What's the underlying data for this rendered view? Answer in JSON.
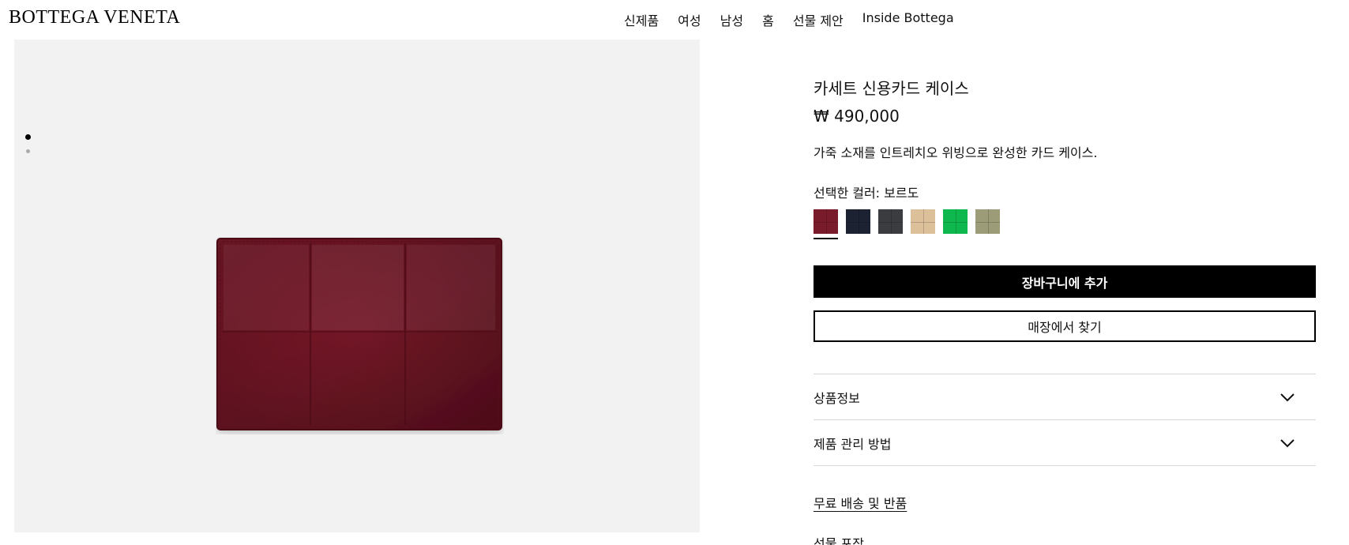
{
  "header": {
    "brand": "BOTTEGA VENETA",
    "nav": [
      "신제품",
      "여성",
      "남성",
      "홈",
      "선물 제안",
      "Inside Bottega"
    ]
  },
  "gallery": {
    "image_count": 2,
    "active_index": 0
  },
  "product": {
    "title": "카세트 신용카드 케이스",
    "price": "₩ 490,000",
    "description": "가죽 소재를 인트레치오 위빙으로 완성한 카드 케이스.",
    "selected_color_label": "선택한 컬러: 보르도",
    "swatches": [
      {
        "color": "#7a1b2b",
        "selected": true
      },
      {
        "color": "#1d2233",
        "selected": false
      },
      {
        "color": "#3b3c40",
        "selected": false
      },
      {
        "color": "#dcc09a",
        "selected": false
      },
      {
        "color": "#0fb84f",
        "selected": false
      },
      {
        "color": "#9c9c78",
        "selected": false
      }
    ],
    "add_to_cart_label": "장바구니에 추가",
    "find_in_store_label": "매장에서 찾기",
    "accordion": [
      "상품정보",
      "제품 관리 방법"
    ],
    "links": [
      "무료 배송 및 반품",
      "선물 포장"
    ]
  }
}
